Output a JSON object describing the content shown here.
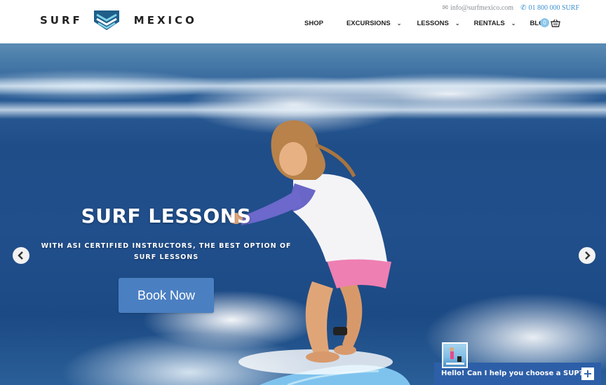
{
  "header": {
    "logo_left": "SURF",
    "logo_right": "MEXICO",
    "email": "info@surfmexico.com",
    "phone": "01 800 000 SURF",
    "nav": [
      {
        "label": "SHOP",
        "has_dropdown": false
      },
      {
        "label": "EXCURSIONS",
        "has_dropdown": true
      },
      {
        "label": "LESSONS",
        "has_dropdown": true
      },
      {
        "label": "RENTALS",
        "has_dropdown": true
      },
      {
        "label": "BLOG",
        "has_dropdown": false
      }
    ],
    "cart_count": "0",
    "icons": {
      "email": "envelope-icon",
      "phone": "phone-icon",
      "cart": "basket-icon"
    },
    "accent_color": "#3a8fd0"
  },
  "hero": {
    "title": "SURF LESSONS",
    "subtitle": "WITH ASI CERTIFIED INSTRUCTORS, THE BEST OPTION OF SURF LESSONS",
    "cta_label": "Book Now",
    "cta_color": "#4a7fc2",
    "icons": {
      "prev": "chevron-left-icon",
      "next": "chevron-right-icon"
    }
  },
  "chat": {
    "label": "Hello! Can I help you choose a SUP?",
    "bar_color": "#2d5fa8",
    "icons": {
      "expand": "plus-icon"
    }
  }
}
